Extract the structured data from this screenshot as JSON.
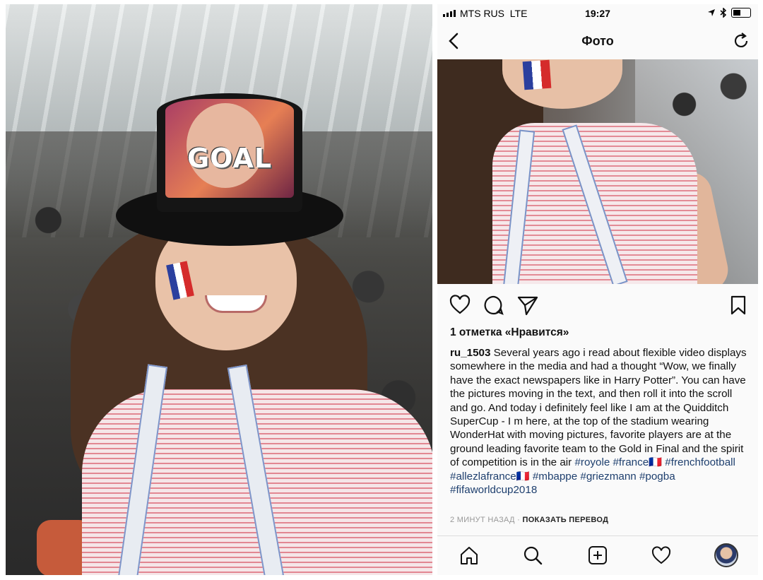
{
  "hat_screen": {
    "text": "GOAL"
  },
  "status_bar": {
    "carrier": "MTS RUS",
    "network": "LTE",
    "time": "19:27"
  },
  "nav": {
    "title": "Фото"
  },
  "post": {
    "likes": "1 отметка «Нравится»",
    "username": "ru_1503",
    "caption": "Several years ago i read about flexible video displays somewhere in the media and had a thought “Wow, we finally have the exact newspapers like in Harry Potter”. You can have the pictures moving in the text, and then roll it into the scroll and go. And today i definitely feel like I am at the Quidditch SuperCup - I m here, at the top of the stadium wearing WonderHat with moving pictures, favorite players are at the ground leading favorite team to the Gold in Final and the spirit of competition is in the air",
    "hashtags": "#royole #france🇫🇷 #frenchfootball #allezlafrance🇫🇷 #mbappe #griezmann #pogba #fifaworldcup2018",
    "time_ago": "2 МИНУТ НАЗАД",
    "translate": "ПОКАЗАТЬ ПЕРЕВОД"
  },
  "colors": {
    "hashtag": "#1e3f6e",
    "background": "#fafafa"
  },
  "icons": {
    "nav": [
      "back-chevron-icon",
      "refresh-icon"
    ],
    "actions": [
      "heart-icon",
      "comment-icon",
      "share-icon",
      "bookmark-icon"
    ],
    "tabs": [
      "home-icon",
      "search-icon",
      "add-post-icon",
      "activity-heart-icon",
      "profile-avatar"
    ]
  }
}
